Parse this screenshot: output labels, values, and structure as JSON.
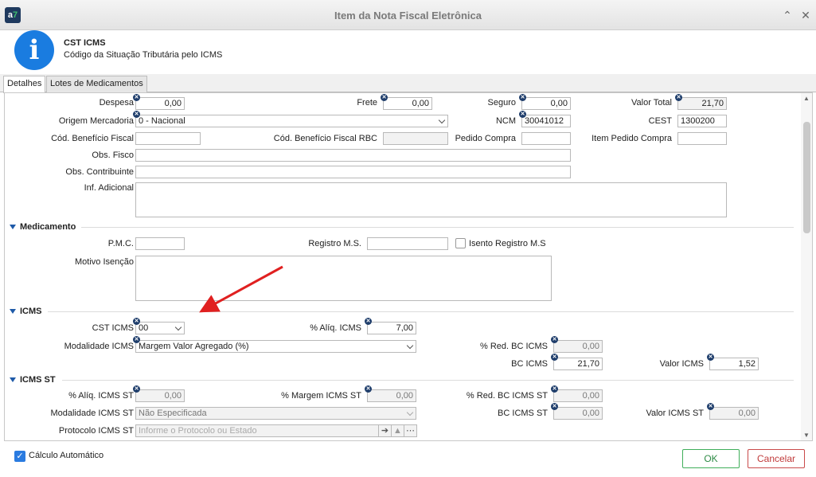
{
  "window": {
    "title": "Item da Nota Fiscal Eletrônica",
    "app_logo": "a7",
    "minimize_glyph": "⌃",
    "close_glyph": "✕"
  },
  "header": {
    "icon": "info-icon",
    "icon_glyph": "i",
    "title": "CST ICMS",
    "subtitle": "Código da Situação Tributária pelo ICMS"
  },
  "tabs": [
    {
      "label": "Detalhes",
      "active": true
    },
    {
      "label": "Lotes de Medicamentos",
      "active": false
    }
  ],
  "detalhes": {
    "despesa_label": "Despesa",
    "despesa_value": "0,00",
    "frete_label": "Frete",
    "frete_value": "0,00",
    "seguro_label": "Seguro",
    "seguro_value": "0,00",
    "valor_total_label": "Valor Total",
    "valor_total_value": "21,70",
    "origem_label": "Origem Mercadoria",
    "origem_value": "0 - Nacional",
    "ncm_label": "NCM",
    "ncm_value": "30041012",
    "cest_label": "CEST",
    "cest_value": "1300200",
    "cod_beneficio_label": "Cód. Benefício Fiscal",
    "cod_beneficio_value": "",
    "cod_beneficio_rbc_label": "Cód. Benefício Fiscal RBC",
    "cod_beneficio_rbc_value": "",
    "pedido_compra_label": "Pedido Compra",
    "pedido_compra_value": "",
    "item_pedido_label": "Item Pedido Compra",
    "item_pedido_value": "",
    "obs_fisco_label": "Obs. Fisco",
    "obs_fisco_value": "",
    "obs_contribuinte_label": "Obs. Contribuinte",
    "obs_contribuinte_value": "",
    "inf_adicional_label": "Inf. Adicional",
    "inf_adicional_value": ""
  },
  "medicamento": {
    "section_title": "Medicamento",
    "pmc_label": "P.M.C.",
    "pmc_value": "",
    "registro_label": "Registro M.S.",
    "registro_value": "",
    "isento_label": "Isento Registro M.S",
    "isento_checked": false,
    "motivo_label": "Motivo Isenção",
    "motivo_value": ""
  },
  "icms": {
    "section_title": "ICMS",
    "cst_label": "CST ICMS",
    "cst_value": "00",
    "aliq_label": "% Alíq. ICMS",
    "aliq_value": "7,00",
    "modalidade_label": "Modalidade ICMS",
    "modalidade_value": "Margem Valor Agregado (%)",
    "red_bc_label": "% Red. BC ICMS",
    "red_bc_value": "0,00",
    "bc_label": "BC ICMS",
    "bc_value": "21,70",
    "valor_label": "Valor ICMS",
    "valor_value": "1,52"
  },
  "icms_st": {
    "section_title": "ICMS ST",
    "aliq_label": "% Alíq. ICMS ST",
    "aliq_value": "0,00",
    "margem_label": "% Margem ICMS ST",
    "margem_value": "0,00",
    "red_bc_label": "% Red. BC ICMS ST",
    "red_bc_value": "0,00",
    "modalidade_label": "Modalidade ICMS ST",
    "modalidade_value": "Não Especificada",
    "bc_label": "BC ICMS ST",
    "bc_value": "0,00",
    "valor_label": "Valor ICMS ST",
    "valor_value": "0,00",
    "protocolo_label": "Protocolo ICMS ST",
    "protocolo_placeholder": "Informe o Protocolo ou Estado"
  },
  "footer": {
    "calculo_label": "Cálculo Automático",
    "calculo_checked": true,
    "ok_label": "OK",
    "cancel_label": "Cancelar"
  },
  "colors": {
    "accent": "#1a7ce0",
    "ok": "#3fae5a",
    "cancel": "#c94a4a",
    "arrow": "#e02020"
  }
}
